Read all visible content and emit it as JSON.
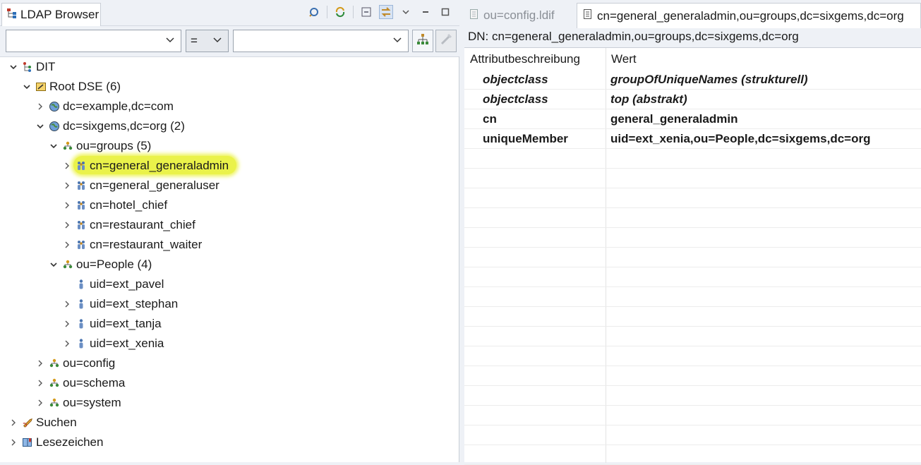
{
  "left_view": {
    "tab_title": "LDAP Browser",
    "tab_icon": "ldap-browser-icon",
    "toolbar_icons": [
      "link-with-editor-icon",
      "refresh-icon",
      "collapse-all-icon",
      "link-icon",
      "view-menu-icon",
      "minimize-icon",
      "maximize-icon"
    ],
    "filter": {
      "attribute_value": "",
      "operator_value": "=",
      "value_value": ""
    },
    "tree": [
      {
        "label": "DIT",
        "icon": "dit-icon",
        "expanded": true,
        "level": 0
      },
      {
        "label": "Root DSE (6)",
        "icon": "root-dse-icon",
        "expanded": true,
        "level": 1
      },
      {
        "label": "dc=example,dc=com",
        "icon": "globe-icon",
        "expanded": false,
        "level": 2
      },
      {
        "label": "dc=sixgems,dc=org (2)",
        "icon": "globe-icon",
        "expanded": true,
        "level": 2
      },
      {
        "label": "ou=groups (5)",
        "icon": "ou-icon",
        "expanded": true,
        "level": 3
      },
      {
        "label": "cn=general_generaladmin",
        "icon": "group-icon",
        "expanded": false,
        "level": 4,
        "selected": true
      },
      {
        "label": "cn=general_generaluser",
        "icon": "group-icon",
        "expanded": false,
        "level": 4
      },
      {
        "label": "cn=hotel_chief",
        "icon": "group-icon",
        "expanded": false,
        "level": 4
      },
      {
        "label": "cn=restaurant_chief",
        "icon": "group-icon",
        "expanded": false,
        "level": 4
      },
      {
        "label": "cn=restaurant_waiter",
        "icon": "group-icon",
        "expanded": false,
        "level": 4
      },
      {
        "label": "ou=People (4)",
        "icon": "ou-icon",
        "expanded": true,
        "level": 3
      },
      {
        "label": "uid=ext_pavel",
        "icon": "person-icon",
        "leaf": true,
        "level": 4
      },
      {
        "label": "uid=ext_stephan",
        "icon": "person-icon",
        "expanded": false,
        "level": 4
      },
      {
        "label": "uid=ext_tanja",
        "icon": "person-icon",
        "expanded": false,
        "level": 4
      },
      {
        "label": "uid=ext_xenia",
        "icon": "person-icon",
        "expanded": false,
        "level": 4
      },
      {
        "label": "ou=config",
        "icon": "ou-icon",
        "expanded": false,
        "level": 2
      },
      {
        "label": "ou=schema",
        "icon": "ou-icon",
        "expanded": false,
        "level": 2
      },
      {
        "label": "ou=system",
        "icon": "ou-icon",
        "expanded": false,
        "level": 2
      },
      {
        "label": "Suchen",
        "icon": "search-rocket-icon",
        "expanded": false,
        "level": 0
      },
      {
        "label": "Lesezeichen",
        "icon": "bookmark-icon",
        "expanded": false,
        "level": 0
      }
    ]
  },
  "editor": {
    "tabs": [
      {
        "label": "ou=config.ldif",
        "icon": "file-icon",
        "active": false
      },
      {
        "label": "cn=general_generaladmin,ou=groups,dc=sixgems,dc=org",
        "icon": "entry-icon",
        "active": true
      }
    ],
    "dn_line": "DN: cn=general_generaladmin,ou=groups,dc=sixgems,dc=org",
    "columns": [
      "Attributbeschreibung",
      "Wert"
    ],
    "rows": [
      {
        "attribute": "objectclass",
        "value": "groupOfUniqueNames (strukturell)",
        "italic": true
      },
      {
        "attribute": "objectclass",
        "value": "top (abstrakt)",
        "italic": true
      },
      {
        "attribute": "cn",
        "value": "general_generaladmin",
        "italic": false
      },
      {
        "attribute": "uniqueMember",
        "value": "uid=ext_xenia,ou=People,dc=sixgems,dc=org",
        "italic": false
      }
    ]
  },
  "colors": {
    "highlight": "#eaf24a",
    "chrome_bg": "#eef1f6",
    "border": "#c9ced6"
  }
}
